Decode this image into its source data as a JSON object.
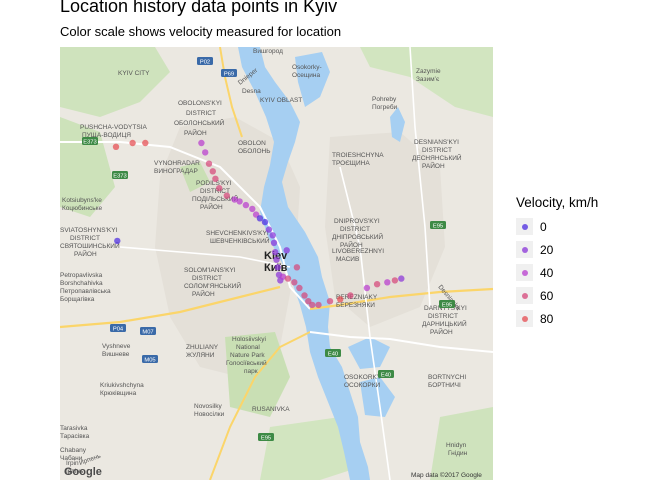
{
  "chart_data": {
    "type": "scatter",
    "title": "Location history data points in Kyiv",
    "subtitle": "Color scale shows velocity measured for location",
    "legend": {
      "title": "Velocity, km/h",
      "placement": "right",
      "entries": [
        {
          "label": "0",
          "velocity": 0,
          "color": "#4b2be0"
        },
        {
          "label": "20",
          "velocity": 20,
          "color": "#8a34d8"
        },
        {
          "label": "40",
          "velocity": 40,
          "color": "#b83ccf"
        },
        {
          "label": "60",
          "velocity": 60,
          "color": "#d6467a"
        },
        {
          "label": "80",
          "velocity": 80,
          "color": "#e64c52"
        }
      ]
    },
    "xlim": [
      30.36,
      30.7
    ],
    "ylim": [
      50.33,
      50.56
    ],
    "points": [
      {
        "lon": 30.404,
        "lat": 50.507,
        "v": 80
      },
      {
        "lon": 30.417,
        "lat": 50.509,
        "v": 80
      },
      {
        "lon": 30.427,
        "lat": 50.509,
        "v": 80
      },
      {
        "lon": 30.405,
        "lat": 50.457,
        "v": 0
      },
      {
        "lon": 30.471,
        "lat": 50.509,
        "v": 40
      },
      {
        "lon": 30.474,
        "lat": 50.504,
        "v": 40
      },
      {
        "lon": 30.477,
        "lat": 50.498,
        "v": 60
      },
      {
        "lon": 30.48,
        "lat": 50.494,
        "v": 60
      },
      {
        "lon": 30.482,
        "lat": 50.49,
        "v": 60
      },
      {
        "lon": 30.485,
        "lat": 50.485,
        "v": 60
      },
      {
        "lon": 30.491,
        "lat": 50.481,
        "v": 60
      },
      {
        "lon": 30.497,
        "lat": 50.479,
        "v": 40
      },
      {
        "lon": 30.501,
        "lat": 50.478,
        "v": 40
      },
      {
        "lon": 30.506,
        "lat": 50.476,
        "v": 40
      },
      {
        "lon": 30.511,
        "lat": 50.474,
        "v": 40
      },
      {
        "lon": 30.514,
        "lat": 50.471,
        "v": 40
      },
      {
        "lon": 30.517,
        "lat": 50.469,
        "v": 0
      },
      {
        "lon": 30.521,
        "lat": 50.467,
        "v": 0
      },
      {
        "lon": 30.524,
        "lat": 50.463,
        "v": 20
      },
      {
        "lon": 30.527,
        "lat": 50.46,
        "v": 20
      },
      {
        "lon": 30.528,
        "lat": 50.456,
        "v": 20
      },
      {
        "lon": 30.529,
        "lat": 50.451,
        "v": 20
      },
      {
        "lon": 30.53,
        "lat": 50.447,
        "v": 20
      },
      {
        "lon": 30.531,
        "lat": 50.443,
        "v": 20
      },
      {
        "lon": 30.532,
        "lat": 50.439,
        "v": 20
      },
      {
        "lon": 30.533,
        "lat": 50.436,
        "v": 20
      },
      {
        "lon": 30.535,
        "lat": 50.438,
        "v": 40
      },
      {
        "lon": 30.539,
        "lat": 50.437,
        "v": 60
      },
      {
        "lon": 30.544,
        "lat": 50.435,
        "v": 60
      },
      {
        "lon": 30.538,
        "lat": 50.452,
        "v": 20
      },
      {
        "lon": 30.546,
        "lat": 50.443,
        "v": 60
      },
      {
        "lon": 30.548,
        "lat": 50.432,
        "v": 60
      },
      {
        "lon": 30.552,
        "lat": 50.428,
        "v": 60
      },
      {
        "lon": 30.555,
        "lat": 50.425,
        "v": 60
      },
      {
        "lon": 30.558,
        "lat": 50.423,
        "v": 60
      },
      {
        "lon": 30.563,
        "lat": 50.423,
        "v": 60
      },
      {
        "lon": 30.572,
        "lat": 50.425,
        "v": 60
      },
      {
        "lon": 30.58,
        "lat": 50.426,
        "v": 80
      },
      {
        "lon": 30.588,
        "lat": 50.428,
        "v": 60
      },
      {
        "lon": 30.601,
        "lat": 50.432,
        "v": 40
      },
      {
        "lon": 30.609,
        "lat": 50.434,
        "v": 60
      },
      {
        "lon": 30.617,
        "lat": 50.435,
        "v": 40
      },
      {
        "lon": 30.623,
        "lat": 50.436,
        "v": 60
      },
      {
        "lon": 30.628,
        "lat": 50.437,
        "v": 20
      }
    ]
  },
  "map": {
    "places": [
      {
        "text": "Вишгород"
      },
      {
        "text": "Osokorky-"
      },
      {
        "text": "Осещина"
      },
      {
        "text": "Zazymie"
      },
      {
        "text": "Зазимʼє"
      },
      {
        "text": "Pohreby"
      },
      {
        "text": "Погреби"
      },
      {
        "text": "OBOLONS'KYI"
      },
      {
        "text": "DISTRICT"
      },
      {
        "text": "ОБОЛОНСЬКИЙ"
      },
      {
        "text": "РАЙОН"
      },
      {
        "text": "PUSHCHA-VODYTSIA"
      },
      {
        "text": "ПУЩА-ВОДИЦЯ"
      },
      {
        "text": "VYNOHRADAR"
      },
      {
        "text": "ВИНОГРАДАР"
      },
      {
        "text": "OBOLON"
      },
      {
        "text": "ОБОЛОНЬ"
      },
      {
        "text": "TROIESHCHYNA"
      },
      {
        "text": "ТРОЄЩИНА"
      },
      {
        "text": "DESNIANS'KYI"
      },
      {
        "text": "DISTRICT"
      },
      {
        "text": "ДЕСНЯНСЬКИЙ"
      },
      {
        "text": "РАЙОН"
      },
      {
        "text": "PODILS'KYI"
      },
      {
        "text": "DISTRICT"
      },
      {
        "text": "ПОДІЛЬСЬКИЙ"
      },
      {
        "text": "РАЙОН"
      },
      {
        "text": "Kotsiubyns'ke"
      },
      {
        "text": "Коцюбинське"
      },
      {
        "text": "SVIATOSHYNS'KYI"
      },
      {
        "text": "DISTRICT"
      },
      {
        "text": "СВЯТОШИНСЬКИЙ"
      },
      {
        "text": "РАЙОН"
      },
      {
        "text": "SHEVCHENKIVS'KYI"
      },
      {
        "text": "ШЕВЧЕНКІВСЬКИЙ"
      },
      {
        "text": "Kiev"
      },
      {
        "text": "Київ"
      },
      {
        "text": "DNIPROVS'KYI"
      },
      {
        "text": "DISTRICT"
      },
      {
        "text": "ДНІПРОВСЬКИЙ"
      },
      {
        "text": "РАЙОН"
      },
      {
        "text": "LIVOBEREZHNYI"
      },
      {
        "text": "МАСИВ"
      },
      {
        "text": "Petropavlivska"
      },
      {
        "text": "Borshchahivka"
      },
      {
        "text": "Петропавлівська"
      },
      {
        "text": "Борщагівка"
      },
      {
        "text": "SOLOM'IANS'KYI"
      },
      {
        "text": "DISTRICT"
      },
      {
        "text": "СОЛОМ'ЯНСЬКИЙ"
      },
      {
        "text": "РАЙОН"
      },
      {
        "text": "BEREZNIAKY"
      },
      {
        "text": "БЕРЕЗНЯКИ"
      },
      {
        "text": "DARNYTS'KYI"
      },
      {
        "text": "DISTRICT"
      },
      {
        "text": "ДАРНИЦЬКИЙ"
      },
      {
        "text": "РАЙОН"
      },
      {
        "text": "Vyshneve"
      },
      {
        "text": "Вишневе"
      },
      {
        "text": "ZHULIANY"
      },
      {
        "text": "ЖУЛЯНИ"
      },
      {
        "text": "Holosiivskyi"
      },
      {
        "text": "National"
      },
      {
        "text": "Nature Park"
      },
      {
        "text": "Голосіївський"
      },
      {
        "text": "парк"
      },
      {
        "text": "Kriukivshchyna"
      },
      {
        "text": "Крюківщина"
      },
      {
        "text": "OSOKORKY"
      },
      {
        "text": "ОСОКОРКИ"
      },
      {
        "text": "BORTNYCHI"
      },
      {
        "text": "БОРТНИЧІ"
      },
      {
        "text": "Novosilky"
      },
      {
        "text": "Новосілки"
      },
      {
        "text": "RUSANIVKA"
      },
      {
        "text": "Tarasivka"
      },
      {
        "text": "Тарасівка"
      },
      {
        "text": "Chabany"
      },
      {
        "text": "Чабани"
      },
      {
        "text": "Hnidyn"
      },
      {
        "text": "Гнідин"
      },
      {
        "text": "Irpin"
      },
      {
        "text": "Ірпінь"
      },
      {
        "text": "KYIV CITY"
      },
      {
        "text": "KYIV OBLAST"
      },
      {
        "text": "Desna"
      },
      {
        "text": "Dnieper"
      },
      {
        "text": "Desnianka"
      },
      {
        "text": "Ирпень"
      }
    ],
    "roads": [
      {
        "text": "P02"
      },
      {
        "text": "P69"
      },
      {
        "text": "E373"
      },
      {
        "text": "E373"
      },
      {
        "text": "E95"
      },
      {
        "text": "E95"
      },
      {
        "text": "E40"
      },
      {
        "text": "E40"
      },
      {
        "text": "P04"
      },
      {
        "text": "M07"
      },
      {
        "text": "M05"
      },
      {
        "text": "E95"
      }
    ],
    "attribution_left": "Google",
    "attribution_right": "Map data ©2017 Google"
  }
}
